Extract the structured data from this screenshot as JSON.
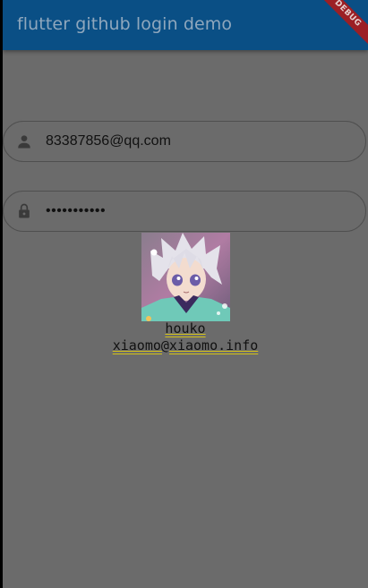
{
  "app_bar": {
    "title": "flutter github login demo",
    "color": "#0a4f85"
  },
  "debug_banner": {
    "label": "DEBUG",
    "color": "#9c1f25"
  },
  "login_form": {
    "username": {
      "icon": "person-icon",
      "value": "83387856@qq.com"
    },
    "password": {
      "icon": "lock-icon",
      "value": "•••••••••••"
    }
  },
  "profile": {
    "avatar": "anime-avatar-image",
    "name": "houko",
    "email": "xiaomo@xiaomo.info"
  },
  "colors": {
    "scrim_background": "#6b6b6b",
    "text_underline": "#d4c219"
  }
}
